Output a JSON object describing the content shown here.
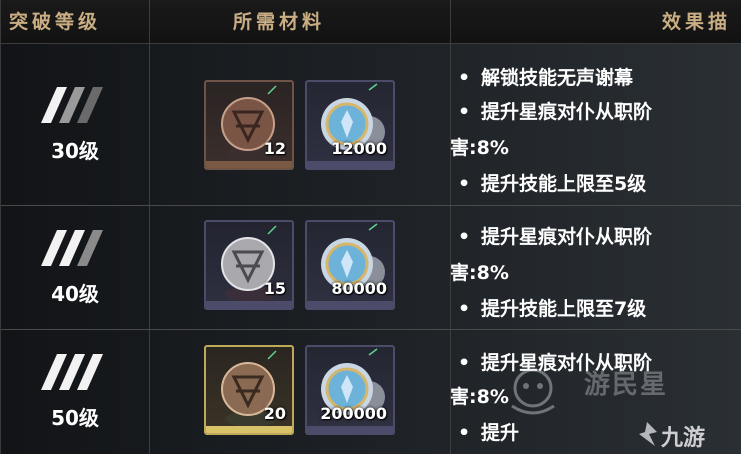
{
  "header": {
    "col_level": "突破等级",
    "col_materials": "所需材料",
    "col_effects": "效果描"
  },
  "rows": [
    {
      "level": "30级",
      "items": [
        {
          "kind": "bronze-emblem",
          "count": "12"
        },
        {
          "kind": "silver-coin",
          "count": "12000"
        }
      ],
      "effects": [
        {
          "bullet": "•",
          "text": "解锁技能无声谢幕"
        },
        {
          "bullet": "•",
          "text": "提升星痕对仆从职阶"
        },
        {
          "bullet": "",
          "text": "害:8%"
        },
        {
          "bullet": "•",
          "text": "提升技能上限至5级"
        }
      ]
    },
    {
      "level": "40级",
      "items": [
        {
          "kind": "silver-emblem",
          "count": "15"
        },
        {
          "kind": "silver-coin",
          "count": "80000"
        }
      ],
      "effects": [
        {
          "bullet": "•",
          "text": "提升星痕对仆从职阶"
        },
        {
          "bullet": "",
          "text": "害:8%"
        },
        {
          "bullet": "•",
          "text": "提升技能上限至7级"
        }
      ]
    },
    {
      "level": "50级",
      "items": [
        {
          "kind": "gold-emblem",
          "count": "20"
        },
        {
          "kind": "silver-coin",
          "count": "200000"
        }
      ],
      "effects": [
        {
          "bullet": "•",
          "text": "提升星痕对仆从职阶"
        },
        {
          "bullet": "",
          "text": "害:8%"
        },
        {
          "bullet": "•",
          "text": "提升"
        }
      ]
    }
  ],
  "watermark": {
    "site_text": "九游",
    "faint_text": "游民星"
  },
  "colors": {
    "header_text": "#c9ad83",
    "bronze_bar": "#7a5a45",
    "silver_bar": "#4c4c6a",
    "gold_bar": "#d9c36a",
    "coin_bar": "#4c4c6a"
  }
}
